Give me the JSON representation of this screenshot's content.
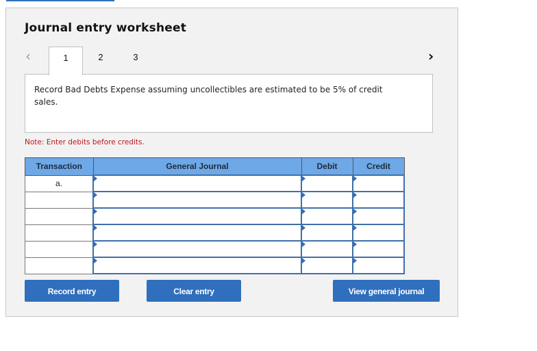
{
  "header": {
    "title": "Journal entry worksheet"
  },
  "nav": {
    "prev_icon": "‹",
    "next_icon": "›",
    "tabs": [
      {
        "label": "1",
        "active": true
      },
      {
        "label": "2",
        "active": false
      },
      {
        "label": "3",
        "active": false
      }
    ]
  },
  "description": "Record Bad Debts Expense assuming uncollectibles are estimated to be 5% of credit sales.",
  "note": "Note: Enter debits before credits.",
  "table": {
    "headers": [
      "Transaction",
      "General Journal",
      "Debit",
      "Credit"
    ],
    "rows": [
      {
        "transaction": "a.",
        "account": "",
        "debit": "",
        "credit": ""
      },
      {
        "transaction": "",
        "account": "",
        "debit": "",
        "credit": ""
      },
      {
        "transaction": "",
        "account": "",
        "debit": "",
        "credit": ""
      },
      {
        "transaction": "",
        "account": "",
        "debit": "",
        "credit": ""
      },
      {
        "transaction": "",
        "account": "",
        "debit": "",
        "credit": ""
      },
      {
        "transaction": "",
        "account": "",
        "debit": "",
        "credit": ""
      }
    ]
  },
  "buttons": {
    "record": "Record entry",
    "clear": "Clear entry",
    "view": "View general journal"
  },
  "colors": {
    "accent": "#2f6fbd",
    "header_bg": "#6fa8e6",
    "note": "#c0141b"
  }
}
